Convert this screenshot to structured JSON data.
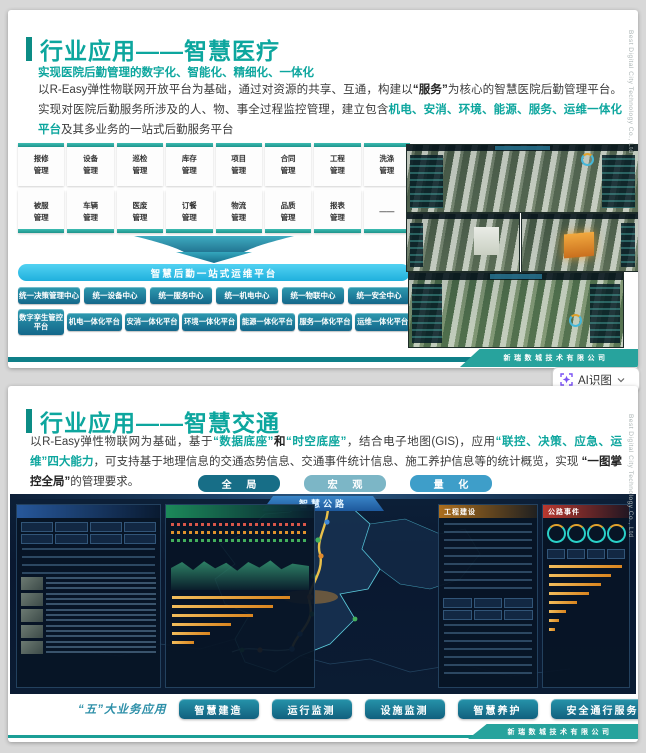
{
  "watermark": "Best Digital City Technology Co., Ltd",
  "company_footer": "新瑞数城技术有限公司",
  "ai_button": {
    "label": "AI识图"
  },
  "slide_medical": {
    "title": "行业应用——智慧医疗",
    "subtitle": "实现医院后勤管理的数字化、智能化、精细化、一体化",
    "paragraph": [
      {
        "t": "以R-Easy弹性物联网开放平台为基础，通过对资源的共享、互通，构建以",
        "c": ""
      },
      {
        "t": "“服务”",
        "c": "b"
      },
      {
        "t": "为核心的智慧医院后勤管理平台。实现对医院后勤服务所涉及的人、物、事全过程监控管理，建立包含",
        "c": ""
      },
      {
        "t": "机电、安消、环境、能源、服务、运维一体化平台",
        "c": "hl"
      },
      {
        "t": "及其多业务的一站式后勤服务平台",
        "c": ""
      }
    ],
    "modules_row1": [
      "报修管理",
      "设备管理",
      "巡检管理",
      "库存管理",
      "项目管理",
      "合同管理",
      "工程管理",
      "洗涤管理"
    ],
    "modules_row2": [
      "被服管理",
      "车辆管理",
      "医废管理",
      "订餐管理",
      "物流管理",
      "品质管理",
      "报表管理",
      "——"
    ],
    "funnel_banner": "智慧后勤一站式运维平台",
    "centers": [
      "统一决策管理中心",
      "统一设备中心",
      "统一服务中心",
      "统一机电中心",
      "统一物联中心",
      "统一安全中心"
    ],
    "platforms": [
      "数字孪生管控平台",
      "机电一体化平台",
      "安消一体化平台",
      "环境一体化平台",
      "能源一体化平台",
      "服务一体化平台",
      "运维一体化平台"
    ]
  },
  "slide_traffic": {
    "title": "行业应用——智慧交通",
    "paragraph": [
      {
        "t": "以R-Easy弹性物联网为基础，基于",
        "c": ""
      },
      {
        "t": "“数据底座”",
        "c": "hl"
      },
      {
        "t": "和",
        "c": "b"
      },
      {
        "t": "“时空底座”",
        "c": "hl"
      },
      {
        "t": "，结合电子地图(GIS)，应用",
        "c": ""
      },
      {
        "t": "“联控、决策、应急、运维”四大能力",
        "c": "hl"
      },
      {
        "t": "，可支持基于地理信息的交通态势信息、交通事件统计信息、施工养护信息等的统计概览，实现 ",
        "c": ""
      },
      {
        "t": "“一图掌控全局”",
        "c": "b"
      },
      {
        "t": "的管理要求。",
        "c": ""
      }
    ],
    "view_buttons": [
      {
        "label": "全 局",
        "bg": "#176e87"
      },
      {
        "label": "宏 观",
        "bg": "#7cb6c6"
      },
      {
        "label": "量 化",
        "bg": "#3e9ec9"
      }
    ],
    "dashboard": {
      "title": "智慧公路",
      "panel_construction": "工程建设",
      "panel_events": "公路事件"
    },
    "biz_label": "“五”大业务应用",
    "biz_buttons": [
      "智慧建造",
      "运行监测",
      "设施监测",
      "智慧养护",
      "安全通行服务"
    ]
  }
}
